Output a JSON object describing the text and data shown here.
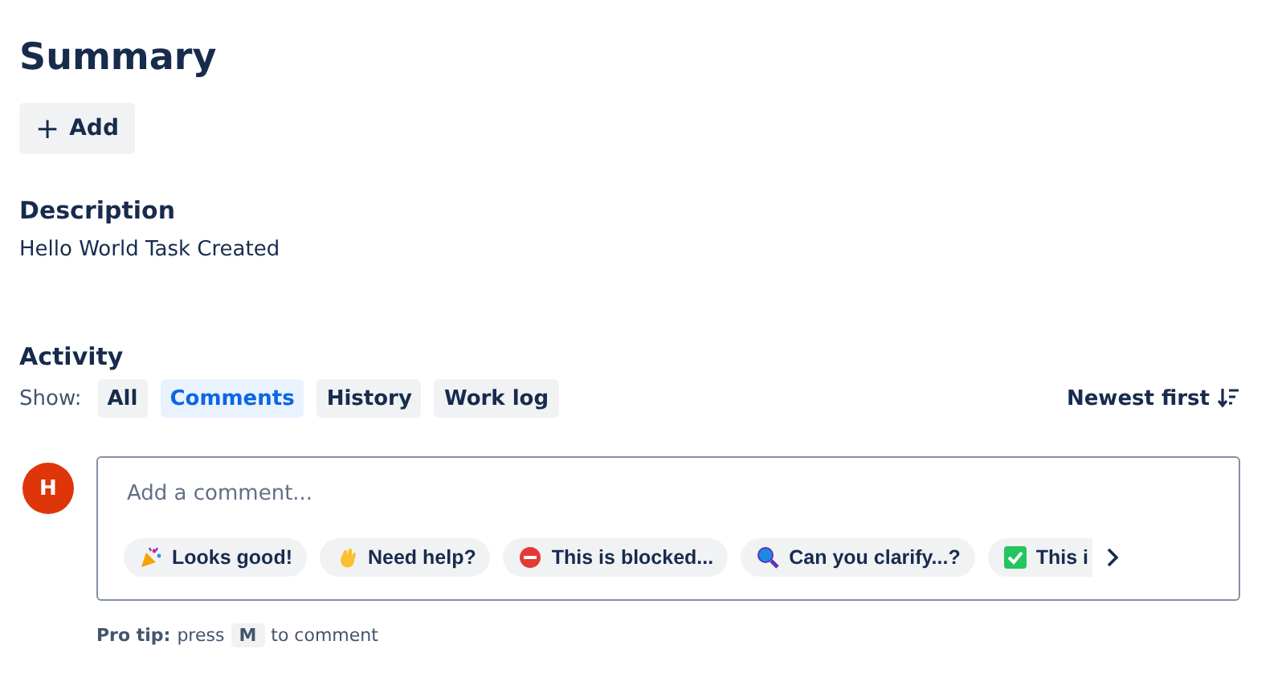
{
  "title": "Summary",
  "add_button": {
    "icon": "+",
    "label": "Add"
  },
  "description": {
    "heading": "Description",
    "text": "Hello World Task Created"
  },
  "activity": {
    "heading": "Activity",
    "show_label": "Show:",
    "filters": [
      {
        "label": "All",
        "selected": false
      },
      {
        "label": "Comments",
        "selected": true
      },
      {
        "label": "History",
        "selected": false
      },
      {
        "label": "Work log",
        "selected": false
      }
    ],
    "sort": "Newest first"
  },
  "comment": {
    "avatar": "H",
    "placeholder": "Add a comment...",
    "quick_replies": [
      {
        "kind": "party",
        "label": "Looks good!"
      },
      {
        "kind": "wave",
        "label": "Need help?"
      },
      {
        "kind": "blocked",
        "label": "This is blocked..."
      },
      {
        "kind": "search",
        "label": "Can you clarify...?"
      },
      {
        "kind": "check",
        "label": "This i",
        "cut": true
      }
    ]
  },
  "pro_tip": {
    "label": "Pro tip:",
    "before": "press",
    "key": "M",
    "after": "to comment"
  }
}
